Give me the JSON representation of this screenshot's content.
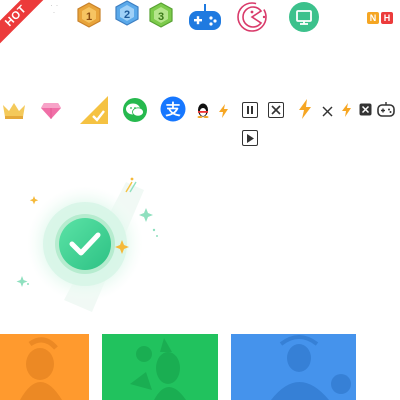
{
  "corner_badge": {
    "label": "HOT",
    "color": "#ec3b3b"
  },
  "level_badges": [
    {
      "number": "1",
      "color": "#d9a23a"
    },
    {
      "number": "2",
      "color": "#4a9de0"
    },
    {
      "number": "3",
      "color": "#7cc94a"
    }
  ],
  "icons_top": [
    "gamepad-icon",
    "pacman-icon",
    "monitor-icon"
  ],
  "mini_badges": [
    {
      "label": "N",
      "color": "#f5a623"
    },
    {
      "label": "H",
      "color": "#ec3b3b"
    }
  ],
  "icons_row2": [
    "crown-icon",
    "diamond-icon",
    "yellow-corner-check-icon",
    "wechat-icon",
    "alipay-icon",
    "qq-penguin-icon",
    "lightning-small-icon",
    "pause-button-icon",
    "close-box-icon",
    "lightning-icon",
    "close-icon",
    "lightning-small-icon",
    "close-box-small-icon",
    "gamepad-outline-icon",
    "play-button-icon"
  ],
  "colors": {
    "success_green": "#3fd28f",
    "thumb_orange": "#ff9a2e",
    "thumb_green": "#21c25e",
    "thumb_blue": "#4593ec"
  },
  "thumbnails": [
    {
      "name": "orange-game-thumbnail",
      "color": "#ff9a2e"
    },
    {
      "name": "green-game-thumbnail",
      "color": "#21c25e"
    },
    {
      "name": "blue-game-thumbnail",
      "color": "#4593ec"
    }
  ]
}
